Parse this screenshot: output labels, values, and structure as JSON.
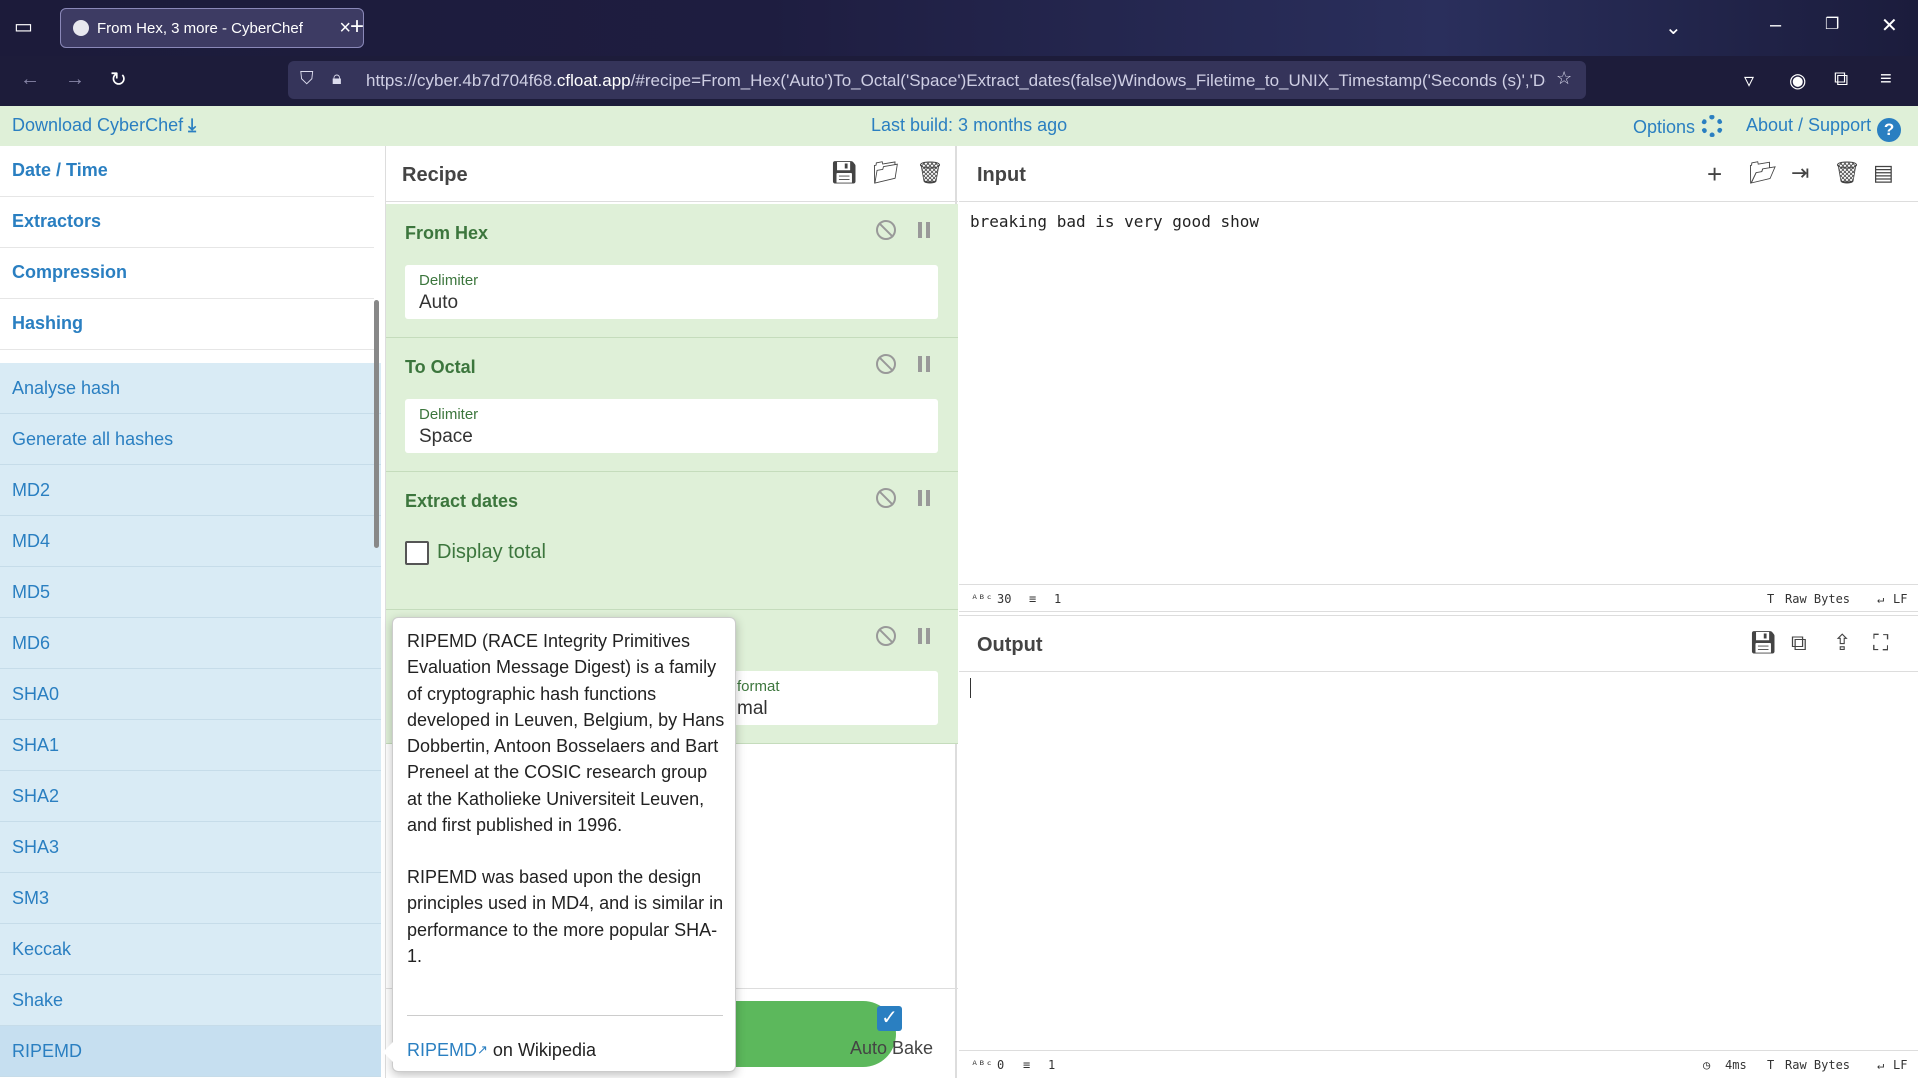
{
  "browser": {
    "tab_title": "From Hex, 3 more - CyberChef",
    "url_prefix": "https://cyber.4b7d704f68.",
    "url_domain": "cfloat.app",
    "url_suffix": "/#recipe=From_Hex('Auto')To_Octal('Space')Extract_dates(false)Windows_Filetime_to_UNIX_Timestamp('Seconds (s)','Dec"
  },
  "banner": {
    "download": "Download CyberChef",
    "last_build": "Last build: 3 months ago",
    "options": "Options",
    "about": "About / Support"
  },
  "operations": {
    "categories": [
      "Date / Time",
      "Extractors",
      "Compression",
      "Hashing"
    ],
    "items": [
      "Analyse hash",
      "Generate all hashes",
      "MD2",
      "MD4",
      "MD5",
      "MD6",
      "SHA0",
      "SHA1",
      "SHA2",
      "SHA3",
      "SM3",
      "Keccak",
      "Shake",
      "RIPEMD"
    ]
  },
  "recipe": {
    "title": "Recipe",
    "steps": [
      {
        "name": "From Hex",
        "field_label": "Delimiter",
        "field_value": "Auto"
      },
      {
        "name": "To Octal",
        "field_label": "Delimiter",
        "field_value": "Space"
      },
      {
        "name": "Extract dates",
        "checkbox_label": "Display total"
      },
      {
        "name": "",
        "field_label": "format",
        "field_value": "mal"
      }
    ],
    "auto_bake": "Auto Bake"
  },
  "input": {
    "title": "Input",
    "text": "breaking bad is very good show",
    "chars": "30",
    "lines": "1",
    "encoding": "Raw Bytes",
    "eol": "LF"
  },
  "output": {
    "title": "Output",
    "chars": "0",
    "lines": "1",
    "time": "4ms",
    "encoding": "Raw Bytes",
    "eol": "LF"
  },
  "popover": {
    "p1": "RIPEMD (RACE Integrity Primitives Evaluation Message Digest) is a family of cryptographic hash functions developed in Leuven, Belgium, by Hans Dobbertin, Antoon Bosselaers and Bart Preneel at the COSIC research group at the Katholieke Universiteit Leuven, and first published in 1996.",
    "p2": "RIPEMD was based upon the design principles used in MD4, and is similar in performance to the more popular SHA-1.",
    "link": "RIPEMD",
    "link_suffix": " on Wikipedia"
  }
}
